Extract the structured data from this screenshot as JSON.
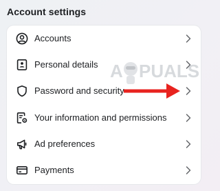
{
  "header": {
    "title": "Account settings"
  },
  "items": [
    {
      "label": "Accounts",
      "icon": "user-circle-icon"
    },
    {
      "label": "Personal details",
      "icon": "id-card-icon"
    },
    {
      "label": "Password and security",
      "icon": "shield-icon"
    },
    {
      "label": "Your information and permissions",
      "icon": "document-settings-icon"
    },
    {
      "label": "Ad preferences",
      "icon": "megaphone-icon"
    },
    {
      "label": "Payments",
      "icon": "credit-card-icon"
    }
  ],
  "watermark": {
    "text": "APPUALS"
  },
  "colors": {
    "arrow": "#e8231f",
    "text": "#1c1e21",
    "chevron": "#65676b"
  }
}
